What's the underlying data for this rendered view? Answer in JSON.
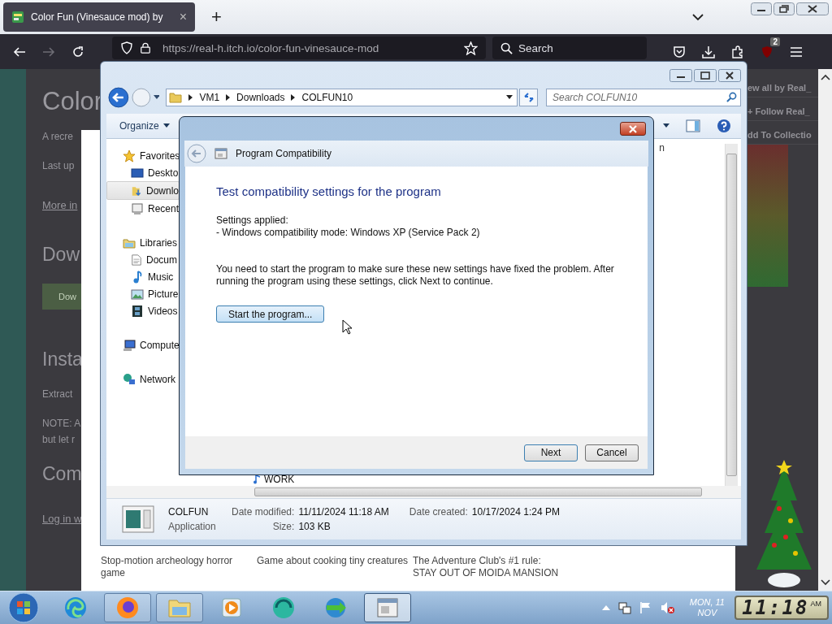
{
  "browser": {
    "tab": {
      "title": "Color Fun (Vinesauce mod) by",
      "close": "×"
    },
    "new_tab": "+",
    "url": "https://real-h.itch.io/color-fun-vinesauce-mod",
    "search": {
      "placeholder": "Search"
    },
    "extension_badge": "2",
    "forward_disabled": true
  },
  "page": {
    "left_texts": [
      {
        "text": "Color",
        "kind": "title"
      },
      {
        "text": "A recre",
        "kind": "text"
      },
      {
        "text": "Last up",
        "kind": "text"
      },
      {
        "text": "More in",
        "kind": "link"
      },
      {
        "text": "Dow",
        "kind": "heading"
      },
      {
        "text": "Dow",
        "kind": "button"
      },
      {
        "text": "Insta",
        "kind": "heading"
      },
      {
        "text": "Extract",
        "kind": "text"
      },
      {
        "text": "NOTE: A",
        "kind": "text"
      },
      {
        "text": "but let r",
        "kind": "text-tight"
      },
      {
        "text": "Com",
        "kind": "heading"
      },
      {
        "text": "Log in w",
        "kind": "link"
      }
    ],
    "right_links": [
      "ew all by Real_",
      "+ Follow Real_",
      "dd To Collectio"
    ],
    "games": [
      "Stop-motion archeology horror game",
      "Game about cooking tiny creatures",
      "The Adventure Club's #1 rule: STAY OUT OF MOIDA MANSION"
    ]
  },
  "explorer": {
    "breadcrumb": [
      "VM1",
      "Downloads",
      "COLFUN10"
    ],
    "search": {
      "placeholder": "Search COLFUN10"
    },
    "organize": "Organize",
    "column_heading": "n",
    "nav": [
      {
        "label": "Favorites",
        "kind": "star",
        "children": [
          {
            "label": "Deskto",
            "kind": "desktop",
            "selected": false
          },
          {
            "label": "Downlo",
            "kind": "download",
            "selected": true
          },
          {
            "label": "Recent",
            "kind": "recent",
            "selected": false
          }
        ]
      },
      {
        "label": "Libraries",
        "kind": "libraries",
        "children": [
          {
            "label": "Docum",
            "kind": "document",
            "selected": false
          },
          {
            "label": "Music",
            "kind": "music",
            "selected": false
          },
          {
            "label": "Picture",
            "kind": "pictures",
            "selected": false
          },
          {
            "label": "Videos",
            "kind": "videos",
            "selected": false
          }
        ]
      },
      {
        "label": "Compute",
        "kind": "computer"
      },
      {
        "label": "Network",
        "kind": "network"
      }
    ],
    "files": [
      {
        "name": "WORK"
      }
    ],
    "details": {
      "name": "COLFUN",
      "type": "Application",
      "fields": [
        {
          "label": "Date modified:",
          "value": "11/11/2024 11:18 AM"
        },
        {
          "label": "Date created:",
          "value": "10/17/2024 1:24 PM"
        },
        {
          "label": "Size:",
          "value": "103 KB"
        }
      ]
    }
  },
  "dialog": {
    "title": "Program Compatibility",
    "heading": "Test compatibility settings for the program",
    "settings_label": "Settings applied:",
    "settings_value": "- Windows compatibility mode: Windows XP (Service Pack 2)",
    "message": "You need to start the program to make sure these new settings have fixed the problem. After running the program using these settings, click Next to continue.",
    "start_button": "Start the program...",
    "buttons": [
      "Next",
      "Cancel"
    ]
  },
  "taskbar": {
    "items": [
      {
        "kind": "edge",
        "open": false,
        "selected": false
      },
      {
        "kind": "firefox",
        "open": true,
        "selected": false
      },
      {
        "kind": "explorer",
        "open": true,
        "selected": false
      },
      {
        "kind": "media",
        "open": false,
        "selected": false
      },
      {
        "kind": "green-app",
        "open": false,
        "selected": false
      },
      {
        "kind": "download-manager",
        "open": false,
        "selected": false
      },
      {
        "kind": "compat",
        "open": true,
        "selected": true
      }
    ],
    "date_line1": "MON, 11",
    "date_line2": "NOV",
    "clock": "11:18",
    "clock_ampm": "AM"
  }
}
